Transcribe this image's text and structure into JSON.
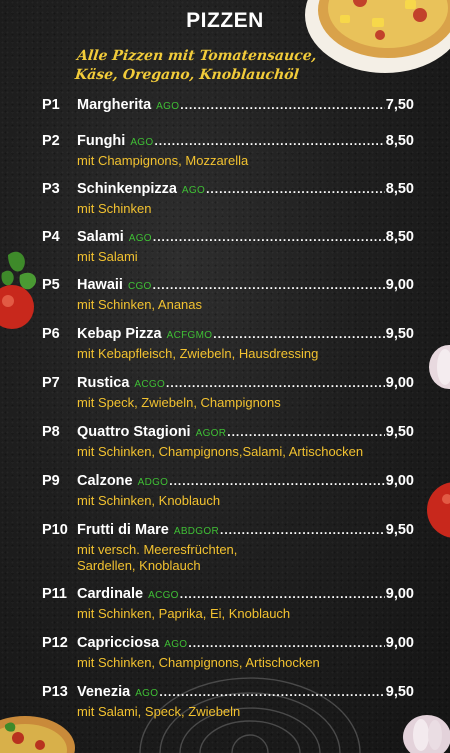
{
  "page": {
    "title": "PIZZEN",
    "subtitle_line1": "Alle Pizzen mit Tomatensauce,",
    "subtitle_line2": "Käse, Oregano, Knoblauchöl"
  },
  "colors": {
    "background": "#1f1f1f",
    "text": "#ffffff",
    "description": "#f2c230",
    "allergen": "#3fbf35",
    "subtitle": "#f2cc3a"
  },
  "items": [
    {
      "code": "P1",
      "name": "Margherita",
      "allergens": "AGO",
      "price": "7,50",
      "desc": []
    },
    {
      "code": "P2",
      "name": "Funghi",
      "allergens": "AGO",
      "price": "8,50",
      "desc": [
        "mit Champignons, Mozzarella"
      ]
    },
    {
      "code": "P3",
      "name": "Schinkenpizza",
      "allergens": "AGO",
      "price": "8,50",
      "desc": [
        "mit Schinken"
      ]
    },
    {
      "code": "P4",
      "name": "Salami",
      "allergens": "AGO",
      "price": "8,50",
      "desc": [
        "mit Salami"
      ]
    },
    {
      "code": "P5",
      "name": "Hawaii",
      "allergens": "CGO",
      "price": "9,00",
      "desc": [
        "mit Schinken, Ananas"
      ]
    },
    {
      "code": "P6",
      "name": "Kebap Pizza",
      "allergens": "ACFGMO",
      "price": "9,50",
      "desc": [
        "mit Kebapfleisch, Zwiebeln, Hausdressing"
      ]
    },
    {
      "code": "P7",
      "name": "Rustica",
      "allergens": "ACGO",
      "price": "9,00",
      "desc": [
        "mit Speck, Zwiebeln, Champignons"
      ]
    },
    {
      "code": "P8",
      "name": "Quattro Stagioni",
      "allergens": "AGOR",
      "price": "9,50",
      "desc": [
        "mit Schinken, Champignons,Salami, Artischocken"
      ]
    },
    {
      "code": "P9",
      "name": "Calzone",
      "allergens": "ADGO",
      "price": "9,00",
      "desc": [
        "mit Schinken, Knoblauch"
      ]
    },
    {
      "code": "P10",
      "name": "Frutti di Mare",
      "allergens": "ABDGOR",
      "price": "9,50",
      "desc": [
        "mit versch. Meeresfrüchten,",
        "Sardellen, Knoblauch"
      ]
    },
    {
      "code": "P11",
      "name": "Cardinale",
      "allergens": "ACGO",
      "price": "9,00",
      "desc": [
        "mit Schinken, Paprika, Ei, Knoblauch"
      ]
    },
    {
      "code": "P12",
      "name": "Capricciosa",
      "allergens": "AGO",
      "price": "9,00",
      "desc": [
        "mit Schinken, Champignons, Artischocken"
      ]
    },
    {
      "code": "P13",
      "name": "Venezia",
      "allergens": "AGO",
      "price": "9,50",
      "desc": [
        "mit Salami, Speck, Zwiebeln"
      ]
    }
  ]
}
